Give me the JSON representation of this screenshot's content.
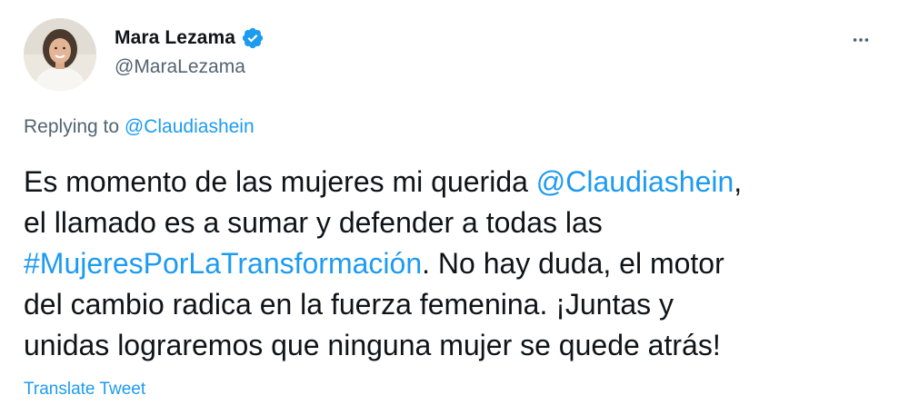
{
  "author": {
    "display_name": "Mara Lezama",
    "handle": "@MaraLezama",
    "verified": true,
    "verified_icon": "verified-badge-icon",
    "avatar_icon": "profile-photo"
  },
  "more_icon": "more-horizontal-icon",
  "reply": {
    "prefix": "Replying to",
    "mention": "@Claudiashein"
  },
  "text": {
    "line1_a": "Es momento de las mujeres mi querida ",
    "line1_mention": "@Claudiashein",
    "line1_b": ",",
    "line2": "el llamado es a sumar y defender a todas las",
    "line3_hashtag": "#MujeresPorLaTransformación",
    "line3_b": ". No hay duda, el motor",
    "line4": "del cambio radica en la fuerza femenina. ¡Juntas y",
    "line5": "unidas lograremos que ninguna mujer se quede atrás!"
  },
  "translate_label": "Translate Tweet",
  "colors": {
    "link": "#1d9bf0",
    "text": "#0f1419",
    "secondary": "#536471"
  }
}
